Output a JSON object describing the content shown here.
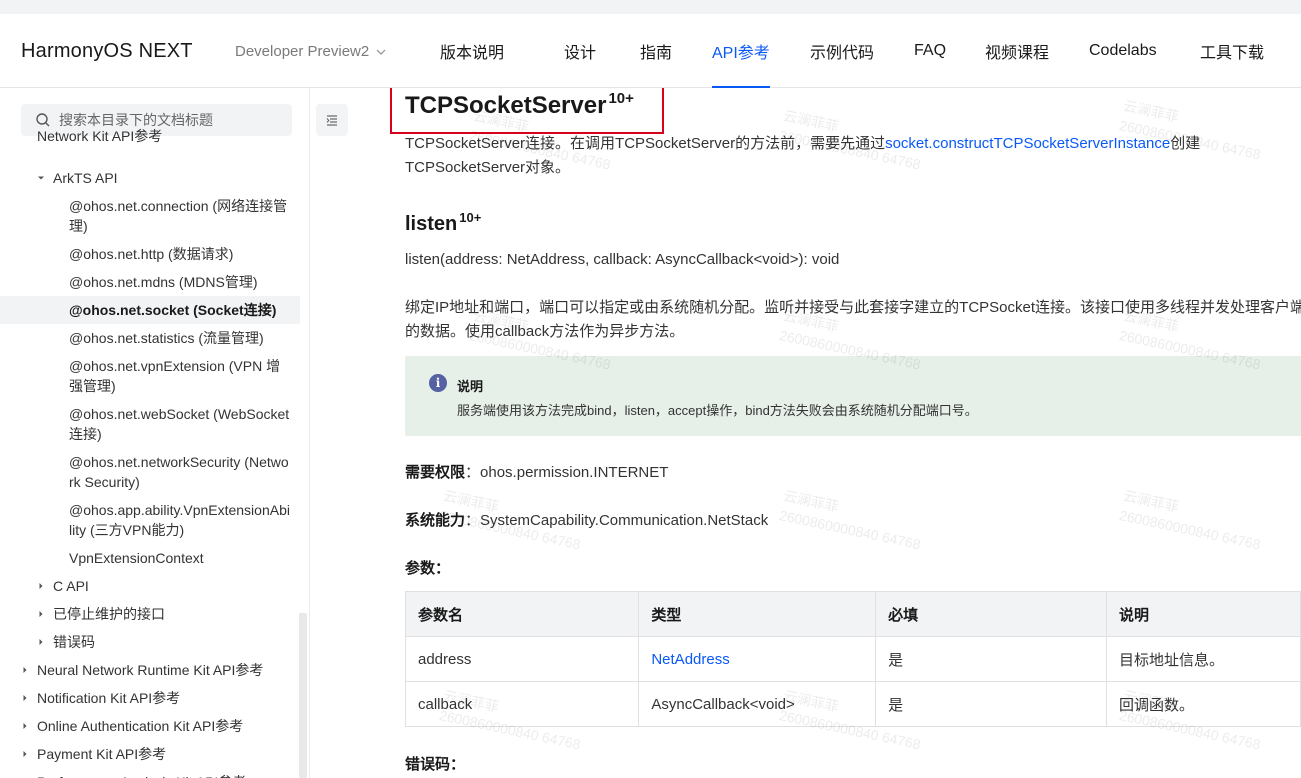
{
  "header": {
    "brand": "HarmonyOS NEXT",
    "version": "Developer Preview2",
    "nav": [
      {
        "label": "版本说明",
        "active": false
      },
      {
        "label": "设计",
        "active": false
      },
      {
        "label": "指南",
        "active": false
      },
      {
        "label": "API参考",
        "active": true
      },
      {
        "label": "示例代码",
        "active": false
      },
      {
        "label": "FAQ",
        "active": false
      },
      {
        "label": "视频课程",
        "active": false
      },
      {
        "label": "Codelabs",
        "active": false
      },
      {
        "label": "工具下载",
        "active": false
      }
    ]
  },
  "sidebar": {
    "search_placeholder": "搜索本目录下的文档标题",
    "items": [
      {
        "label": "Network Kit API参考",
        "caret": "none",
        "active": false
      },
      {
        "label": "ArkTS API",
        "caret": "down",
        "active": false
      },
      {
        "label": "@ohos.net.connection (网络连接管理)",
        "caret": "none",
        "active": false
      },
      {
        "label": "@ohos.net.http (数据请求)",
        "caret": "none",
        "active": false
      },
      {
        "label": "@ohos.net.mdns (MDNS管理)",
        "caret": "none",
        "active": false
      },
      {
        "label": "@ohos.net.socket (Socket连接)",
        "caret": "none",
        "active": true
      },
      {
        "label": "@ohos.net.statistics (流量管理)",
        "caret": "none",
        "active": false
      },
      {
        "label": "@ohos.net.vpnExtension (VPN 增强管理)",
        "caret": "none",
        "active": false
      },
      {
        "label": "@ohos.net.webSocket (WebSocket连接)",
        "caret": "none",
        "active": false
      },
      {
        "label": "@ohos.net.networkSecurity (Network Security)",
        "caret": "none",
        "active": false
      },
      {
        "label": "@ohos.app.ability.VpnExtensionAbility (三方VPN能力)",
        "caret": "none",
        "active": false
      },
      {
        "label": "VpnExtensionContext",
        "caret": "none",
        "active": false
      },
      {
        "label": "C API",
        "caret": "right",
        "active": false
      },
      {
        "label": "已停止维护的接口",
        "caret": "right",
        "active": false
      },
      {
        "label": "错误码",
        "caret": "right",
        "active": false
      },
      {
        "label": "Neural Network Runtime Kit API参考",
        "caret": "right",
        "active": false
      },
      {
        "label": "Notification Kit API参考",
        "caret": "right",
        "active": false
      },
      {
        "label": "Online Authentication Kit API参考",
        "caret": "right",
        "active": false
      },
      {
        "label": "Payment Kit API参考",
        "caret": "right",
        "active": false
      },
      {
        "label": "Performance Analysis Kit API参考",
        "caret": "right",
        "active": false
      }
    ]
  },
  "content": {
    "title": "TCPSocketServer",
    "title_sup": "10+",
    "intro_pre": "TCPSocketServer连接。在调用TCPSocketServer的方法前，需要先通过",
    "intro_link": "socket.constructTCPSocketServerInstance",
    "intro_post": "创建TCPSocketServer对象。",
    "method_title": "listen",
    "method_sup": "10+",
    "signature": "listen(address: NetAddress, callback: AsyncCallback<void>): void",
    "description_line1": "绑定IP地址和端口，端口可以指定或由系统随机分配。监听并接受与此套接字建立的TCPSocket连接。该接口使用多线程并发处理客户端",
    "description_line2": "的数据。使用callback方法作为异步方法。",
    "note_title": "说明",
    "note_text": "服务端使用该方法完成bind，listen，accept操作，bind方法失败会由系统随机分配端口号。",
    "permission_label": "需要权限",
    "permission_value": "ohos.permission.INTERNET",
    "syscap_label": "系统能力",
    "syscap_value": "SystemCapability.Communication.NetStack",
    "params_heading": "参数：",
    "table_headers": [
      "参数名",
      "类型",
      "必填",
      "说明"
    ],
    "table_rows": [
      {
        "name": "address",
        "type": "NetAddress",
        "type_is_link": true,
        "required": "是",
        "desc": "目标地址信息。"
      },
      {
        "name": "callback",
        "type": "AsyncCallback<void>",
        "type_is_link": false,
        "required": "是",
        "desc": "回调函数。"
      }
    ],
    "errors_heading": "错误码："
  },
  "watermark": {
    "name": "云澜菲菲",
    "number": "2600860000840 64768"
  },
  "colors": {
    "accent": "#0a59f7",
    "highlight_box": "#d9001b",
    "note_bg": "#e6efe8"
  }
}
